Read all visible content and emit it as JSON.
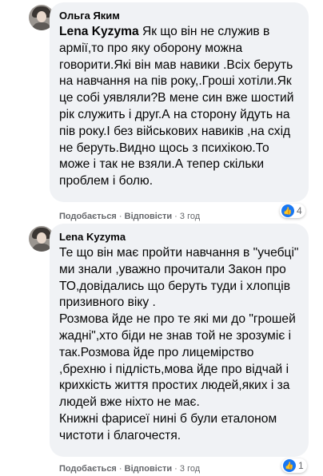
{
  "comments": [
    {
      "author": "Ольга Яким",
      "mention": "Lena Kyzyma",
      "text": " Як що він не служив в армії,то про яку оборону можна говорити.Які він мав навики .Всіх беруть на навчання на пів року,.Гроші хотіли.Як це собі уявляли?В мене син вже шостий рік служить і друг.А на сторону йдуть на пів року.І без військових навиків ,на схід не беруть.Видно щось з психікою.То може і так не взяли.А тепер скільки проблем і болю.",
      "like_label": "Подобається",
      "reply_label": "Відповісти",
      "time": "3 год",
      "reaction_count": "4"
    },
    {
      "author": "Lena Kyzyma",
      "text": "Те що він має пройти навчання в \"учебці\" ми знали ,уважно прочитали Закон про ТО,довідались що беруть туди і хлопців призивного віку .\nРозмова йде не про те які ми до \"грошей жадні\",хто біди не знав той не зрозуміє і так.Розмова йде про лицемірство ,брехню і підлість,мова йде про відчай і крихкість життя простих людей,яких і за людей вже ніхто не має.\nКнижні фарисеї нині б були еталоном чистоти і благочестя.",
      "like_label": "Подобається",
      "reply_label": "Відповісти",
      "time": "3 год",
      "reaction_count": "1"
    }
  ],
  "colors": {
    "like_blue": "#1877f2",
    "bubble_bg": "#f0f2f5",
    "meta_gray": "#65676b"
  },
  "icons": {
    "reaction": "thumbs-up-icon"
  }
}
